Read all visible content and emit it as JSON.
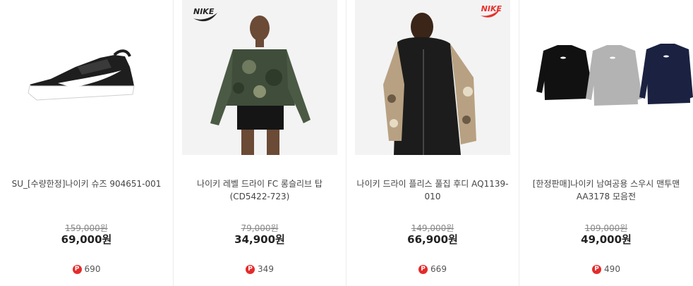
{
  "products": [
    {
      "title": "SU_[수량한정]나이키 슈즈 904651-001",
      "original_price": "159,000원",
      "price": "69,000원",
      "points": "690",
      "image": "black-white-running-shoe"
    },
    {
      "title": "나이키 레벨 드라이 FC 롱슬리브 탑 (CD5422-723)",
      "original_price": "79,000원",
      "price": "34,900원",
      "points": "349",
      "image": "camo-long-sleeve-top-model",
      "brand_logo": "NIKE"
    },
    {
      "title": "나이키 드라이 플리스 풀집 후디 AQ1139-010",
      "original_price": "149,000원",
      "price": "66,900원",
      "points": "669",
      "image": "camo-sleeve-full-zip-hoodie-model",
      "brand_logo": "NIKE"
    },
    {
      "title": "[한정판매]나이키 남여공용 스우시 맨투맨 AA3178 모음전",
      "original_price": "109,000원",
      "price": "49,000원",
      "points": "490",
      "image": "three-crewneck-sweatshirts"
    }
  ],
  "point_icon_label": "P",
  "colors": {
    "point_badge": "#e52b2b",
    "nike_logo_red": "#e8312d"
  }
}
